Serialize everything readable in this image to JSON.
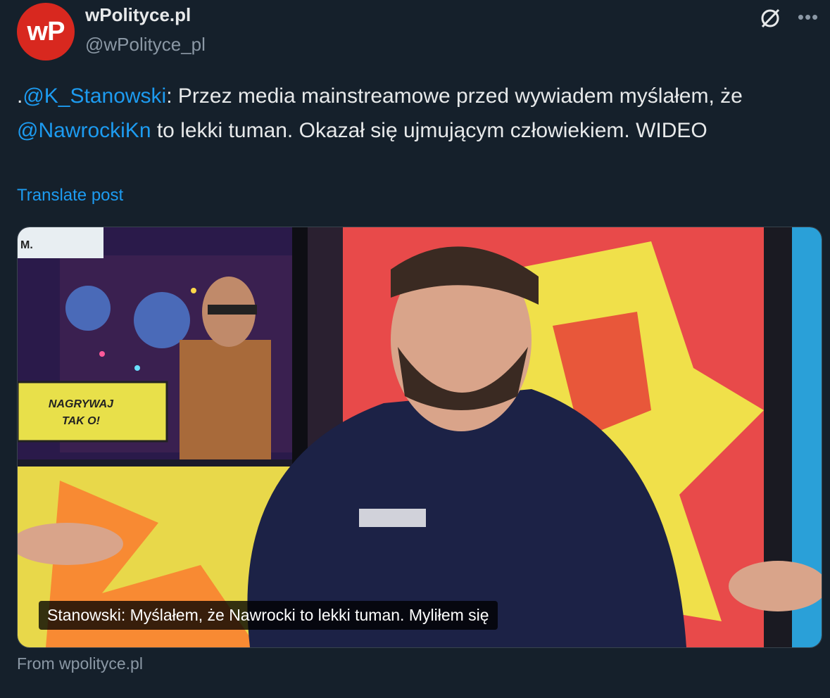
{
  "author": {
    "avatar_text": "wP",
    "name": "wPolityce.pl",
    "handle": "@wPolityce_pl"
  },
  "header_icons": [
    "grok-icon",
    "more-icon"
  ],
  "post": {
    "prefix": ".",
    "mention1": "@K_Stanowski",
    "text1": ": Przez media mainstreamowe przed wywiadem myślałem, że ",
    "mention2": "@NawrockiKn",
    "text2": " to lekki tuman. Okazał się ujmującym człowiekiem. WIDEO",
    "translate": "Translate post"
  },
  "media": {
    "sign_text_line1": "NAGRYWAJ",
    "sign_text_line2": "TAK O!",
    "corner_label": "M.",
    "caption": "Stanowski: Myślałem, że Nawrocki to lekki tuman. Myliłem się"
  },
  "source": "From wpolityce.pl",
  "colors": {
    "background": "#15202b",
    "link": "#1d9bf0",
    "secondary": "#8b98a5",
    "avatar": "#d8281f"
  }
}
